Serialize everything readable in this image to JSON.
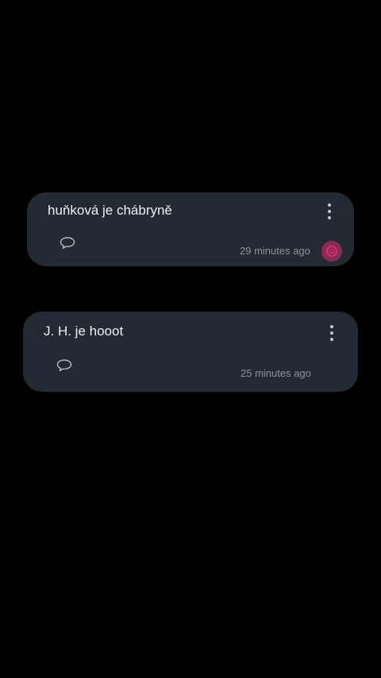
{
  "posts": [
    {
      "text": "huňková je chábryně",
      "time": "29 minutes ago",
      "comment_icon": "speech-bubble-icon",
      "menu_icon": "more-vertical-icon",
      "reaction_icon": "emoji-reaction-icon",
      "reaction_active": true
    },
    {
      "text": "J. H. je hooot",
      "time": "25 minutes ago",
      "comment_icon": "speech-bubble-icon",
      "menu_icon": "more-vertical-icon"
    }
  ],
  "colors": {
    "background": "#000000",
    "card": "#242a33",
    "text": "#eef0f2",
    "muted": "#8d939a",
    "reaction_bg": "#8a2a55",
    "reaction_fg": "#e0307a"
  }
}
